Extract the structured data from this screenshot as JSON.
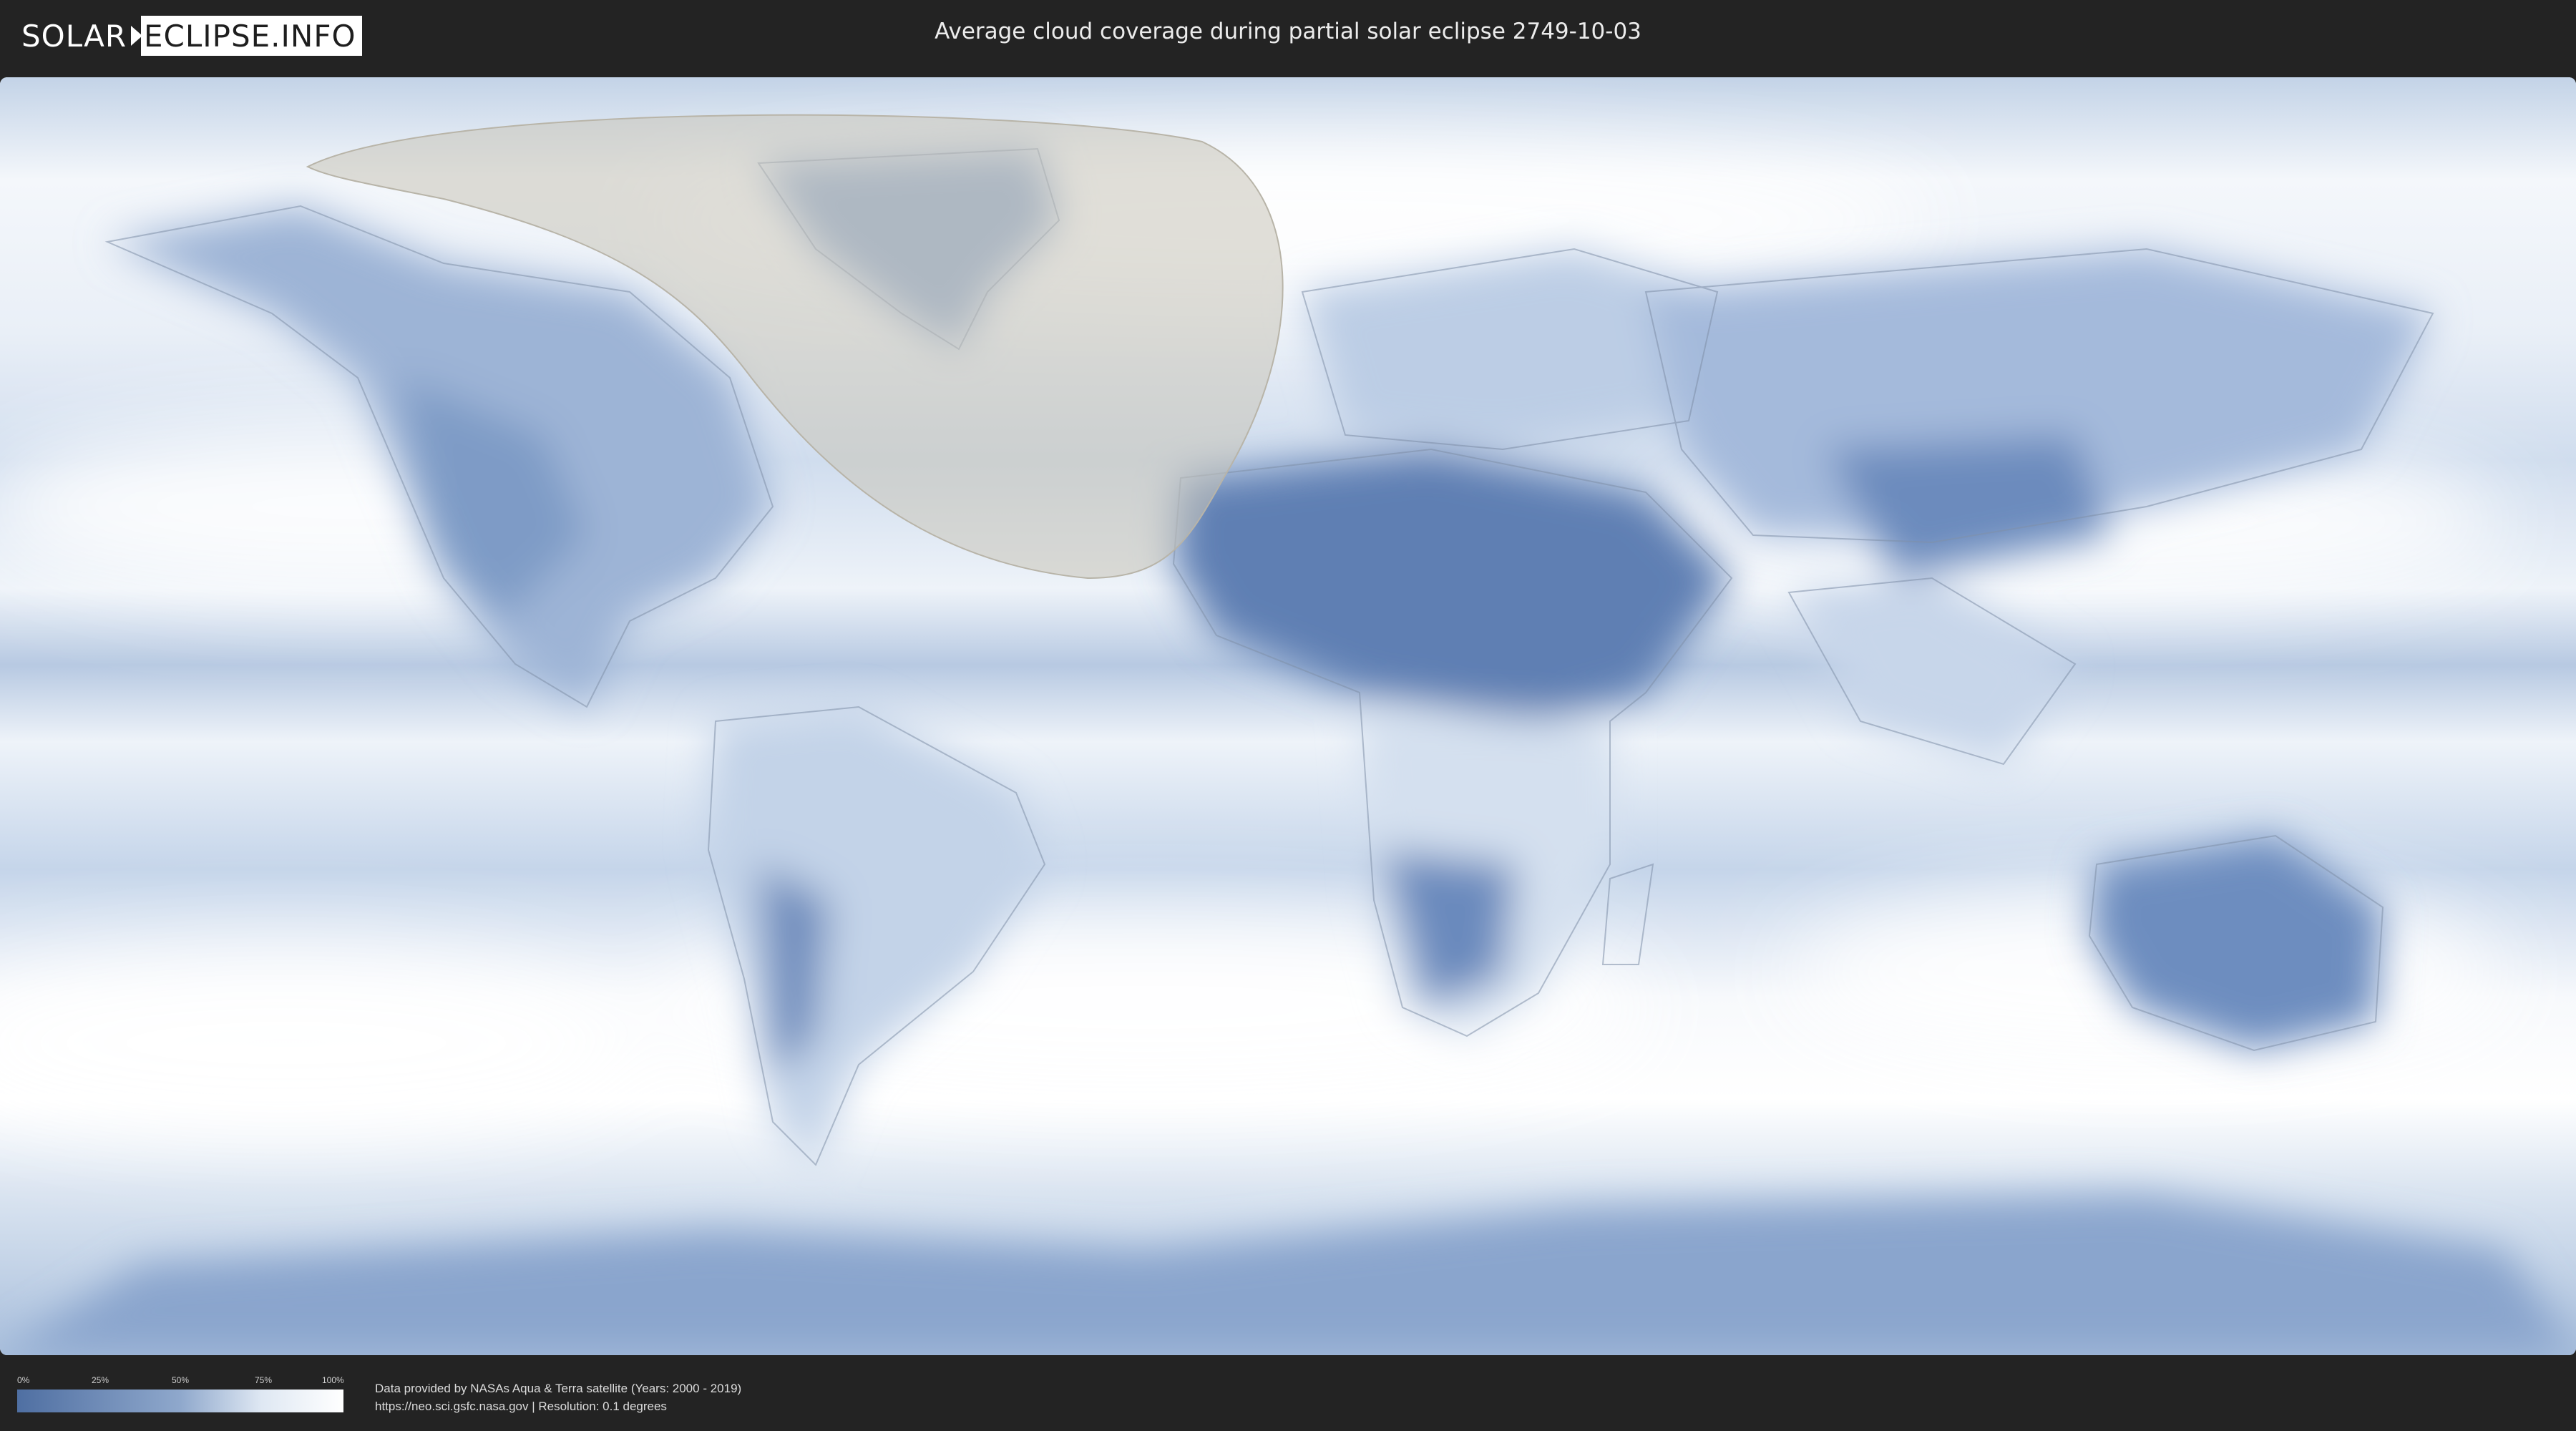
{
  "header": {
    "logo_left": "SOLAR",
    "logo_right": "ECLIPSE.INFO",
    "title": "Average cloud coverage during partial solar eclipse 2749-10-03"
  },
  "legend": {
    "ticks": [
      "0%",
      "25%",
      "50%",
      "75%",
      "100%"
    ]
  },
  "credit": {
    "line1": "Data provided by NASAs Aqua & Terra satellite (Years: 2000 - 2019)",
    "line2": "https://neo.sci.gsfc.nasa.gov | Resolution: 0.1 degrees"
  },
  "colors": {
    "clear_sky": "#4f6fa2",
    "full_cloud": "#ffffff",
    "eclipse_zone": "#c8c4b8"
  }
}
